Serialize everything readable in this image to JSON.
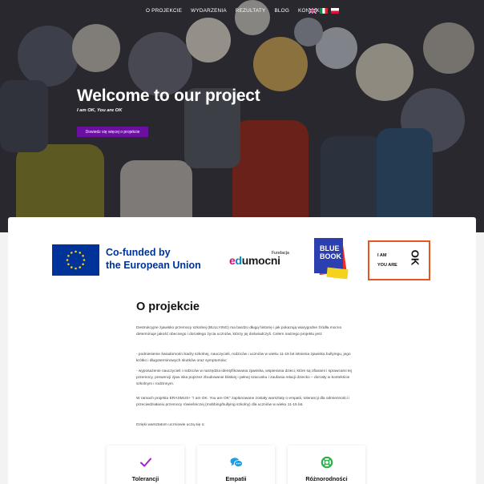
{
  "nav": {
    "items": [
      "O PROJEKCIE",
      "WYDARZENIA",
      "REZULTATY",
      "BLOG",
      "KONTAKT"
    ],
    "flags": [
      "uk-flag-icon",
      "italy-flag-icon",
      "poland-flag-icon"
    ]
  },
  "hero": {
    "title": "Welcome to our project",
    "subtitle": "I am OK, You are OK",
    "button_label": "Dowiedz się więcej o projekcie"
  },
  "logos": {
    "eu_line1": "Co-funded by",
    "eu_line2": "the European Union",
    "edu_small": "Fundacja",
    "edu_e": "e",
    "edu_d": "d",
    "edu_rest": "umocni",
    "bluebook_line1": "BLUE",
    "bluebook_line2": "BOOK",
    "iamok_line1": "I AM",
    "iamok_line2": "YOU ARE",
    "iamok_ok": "OK"
  },
  "about": {
    "title": "O projekcie",
    "paragraphs": [
      "Destrukcyjne zjawisko przemocy szkolnej (BULLYING) ma bardzo długą historię i jak pokazują wiarygodne źródła mocno determinuje jakość obecnego i dorosłego życia uczniów, którzy jej doświadczyli. Celem naszego projektu jest:",
      "- podniesienie świadomości kadry szkolnej, nauczycieli, rodziców i uczniów w wieku 11-15 lat istnienia zjawiska bullyingu, jego krótko i długoterminowych skutków oraz symptomów;",
      "- wyposażenie nauczycieli i rodziców w narzędzia identyfikowania zjawiska, wspierania dzieci, które są ofiarami i sprawcami tej przemocy, prewencji zjaw iska poprzez zbudowanie bliskiej i pełnej szacunku i zaufania relacji dziecko – dorosły w kontekście szkolnym i rodzinnym.",
      "W ramach projektu ERASMUS+ \"I am OK. You are OK\" zaplanowane zostały warsztaty o empatii, tolerancji dla odmienności i przeciwdziałaniu przemocy rówieśniczej (mobbing/bullying szkolny) dla uczniów w wieku 11-15 lat.",
      "Dzięki warsztatom uczniowie uczą się o:"
    ]
  },
  "features": [
    {
      "label": "Tolerancji",
      "icon": "check-icon"
    },
    {
      "label": "Empatii",
      "icon": "chat-bubbles-icon"
    },
    {
      "label": "Różnorodności",
      "icon": "lifebuoy-icon"
    }
  ],
  "colors": {
    "accent": "#6a0fa0",
    "eu_blue": "#003399",
    "check": "#a222c9",
    "chat": "#1e9fe0",
    "lifebuoy": "#2eb14a",
    "iamok_border": "#e8561f"
  }
}
